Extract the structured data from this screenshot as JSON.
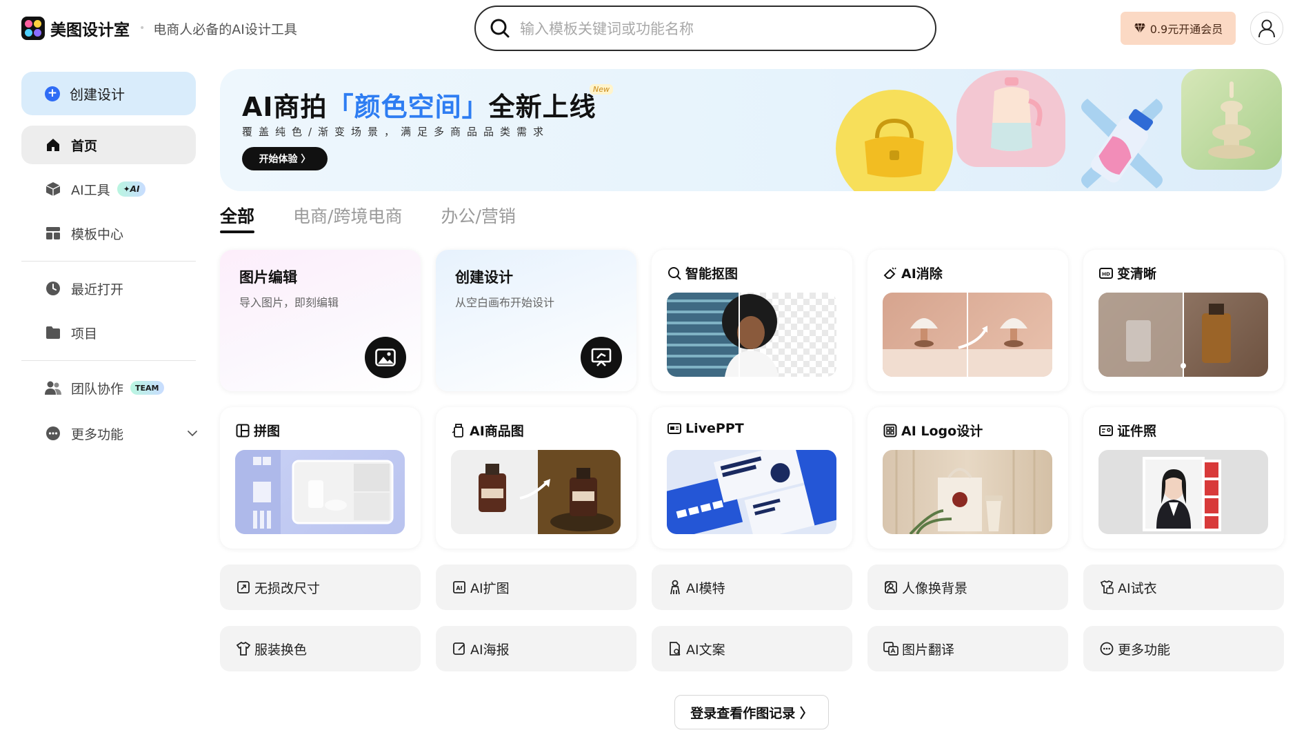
{
  "header": {
    "brand": "美图设计室",
    "slogan": "电商人必备的AI设计工具",
    "search_placeholder": "输入模板关键词或功能名称",
    "vip_label": "0.9元开通会员"
  },
  "sidebar": {
    "create_label": "创建设计",
    "items": [
      {
        "label": "首页",
        "icon": "home-icon",
        "active": true
      },
      {
        "label": "AI工具",
        "icon": "ai-tools-icon",
        "badge": "✦AI"
      },
      {
        "label": "模板中心",
        "icon": "template-icon"
      },
      {
        "label": "最近打开",
        "icon": "clock-icon"
      },
      {
        "label": "项目",
        "icon": "folder-icon"
      },
      {
        "label": "团队协作",
        "icon": "team-icon",
        "badge": "TEAM"
      },
      {
        "label": "更多功能",
        "icon": "more-icon"
      }
    ]
  },
  "banner": {
    "title_a": "AI商拍",
    "title_hl": "「颜色空间」",
    "title_b": "全新上线",
    "new_badge": "New",
    "subtitle": "覆盖纯色/渐变场景，满足多商品品类需求",
    "cta": "开始体验 〉"
  },
  "tabs": [
    "全部",
    "电商/跨境电商",
    "办公/营销"
  ],
  "big_cards": [
    {
      "title": "图片编辑",
      "subtitle": "导入图片，即刻编辑",
      "icon": "image-icon"
    },
    {
      "title": "创建设计",
      "subtitle": "从空白画布开始设计",
      "icon": "canvas-icon"
    }
  ],
  "feature_cards": [
    {
      "title": "智能抠图",
      "icon": "cutout-icon"
    },
    {
      "title": "AI消除",
      "icon": "eraser-icon"
    },
    {
      "title": "变清晰",
      "icon": "hd-icon"
    },
    {
      "title": "拼图",
      "icon": "collage-icon"
    },
    {
      "title": "AI商品图",
      "icon": "product-icon"
    },
    {
      "title": "LivePPT",
      "icon": "ppt-icon"
    },
    {
      "title": "AI Logo设计",
      "icon": "logo-design-icon"
    },
    {
      "title": "证件照",
      "icon": "id-photo-icon"
    }
  ],
  "quick_tools": [
    {
      "label": "无损改尺寸",
      "icon": "resize-icon"
    },
    {
      "label": "AI扩图",
      "icon": "expand-icon"
    },
    {
      "label": "AI模特",
      "icon": "model-icon"
    },
    {
      "label": "人像换背景",
      "icon": "bg-swap-icon"
    },
    {
      "label": "AI试衣",
      "icon": "tryon-icon"
    },
    {
      "label": "服装换色",
      "icon": "shirt-icon"
    },
    {
      "label": "AI海报",
      "icon": "poster-icon"
    },
    {
      "label": "AI文案",
      "icon": "copywriting-icon"
    },
    {
      "label": "图片翻译",
      "icon": "translate-icon"
    },
    {
      "label": "更多功能",
      "icon": "more-icon"
    }
  ],
  "login_record": "登录查看作图记录 〉"
}
